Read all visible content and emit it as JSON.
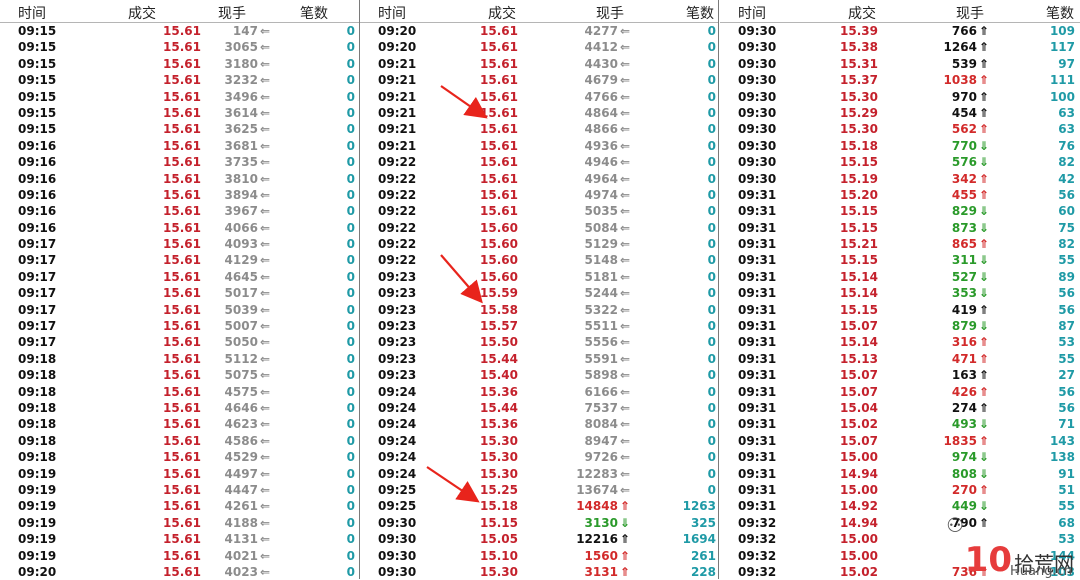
{
  "headers": {
    "time": "时间",
    "price": "成交",
    "vol": "现手",
    "count": "笔数"
  },
  "columns": [
    [
      [
        "09:15",
        "15.61",
        "147",
        "n",
        "0"
      ],
      [
        "09:15",
        "15.61",
        "3065",
        "n",
        "0"
      ],
      [
        "09:15",
        "15.61",
        "3180",
        "n",
        "0"
      ],
      [
        "09:15",
        "15.61",
        "3232",
        "n",
        "0"
      ],
      [
        "09:15",
        "15.61",
        "3496",
        "n",
        "0"
      ],
      [
        "09:15",
        "15.61",
        "3614",
        "n",
        "0"
      ],
      [
        "09:15",
        "15.61",
        "3625",
        "n",
        "0"
      ],
      [
        "09:16",
        "15.61",
        "3681",
        "n",
        "0"
      ],
      [
        "09:16",
        "15.61",
        "3735",
        "n",
        "0"
      ],
      [
        "09:16",
        "15.61",
        "3810",
        "n",
        "0"
      ],
      [
        "09:16",
        "15.61",
        "3894",
        "n",
        "0"
      ],
      [
        "09:16",
        "15.61",
        "3967",
        "n",
        "0"
      ],
      [
        "09:16",
        "15.61",
        "4066",
        "n",
        "0"
      ],
      [
        "09:17",
        "15.61",
        "4093",
        "n",
        "0"
      ],
      [
        "09:17",
        "15.61",
        "4129",
        "n",
        "0"
      ],
      [
        "09:17",
        "15.61",
        "4645",
        "n",
        "0"
      ],
      [
        "09:17",
        "15.61",
        "5017",
        "n",
        "0"
      ],
      [
        "09:17",
        "15.61",
        "5039",
        "n",
        "0"
      ],
      [
        "09:17",
        "15.61",
        "5007",
        "n",
        "0"
      ],
      [
        "09:17",
        "15.61",
        "5050",
        "n",
        "0"
      ],
      [
        "09:18",
        "15.61",
        "5112",
        "n",
        "0"
      ],
      [
        "09:18",
        "15.61",
        "5075",
        "n",
        "0"
      ],
      [
        "09:18",
        "15.61",
        "4575",
        "n",
        "0"
      ],
      [
        "09:18",
        "15.61",
        "4646",
        "n",
        "0"
      ],
      [
        "09:18",
        "15.61",
        "4623",
        "n",
        "0"
      ],
      [
        "09:18",
        "15.61",
        "4586",
        "n",
        "0"
      ],
      [
        "09:18",
        "15.61",
        "4529",
        "n",
        "0"
      ],
      [
        "09:19",
        "15.61",
        "4497",
        "n",
        "0"
      ],
      [
        "09:19",
        "15.61",
        "4447",
        "n",
        "0"
      ],
      [
        "09:19",
        "15.61",
        "4261",
        "n",
        "0"
      ],
      [
        "09:19",
        "15.61",
        "4188",
        "n",
        "0"
      ],
      [
        "09:19",
        "15.61",
        "4131",
        "n",
        "0"
      ],
      [
        "09:19",
        "15.61",
        "4021",
        "n",
        "0"
      ],
      [
        "09:20",
        "15.61",
        "4023",
        "n",
        "0"
      ]
    ],
    [
      [
        "09:20",
        "15.61",
        "4277",
        "n",
        "0"
      ],
      [
        "09:20",
        "15.61",
        "4412",
        "n",
        "0"
      ],
      [
        "09:21",
        "15.61",
        "4430",
        "n",
        "0"
      ],
      [
        "09:21",
        "15.61",
        "4679",
        "n",
        "0"
      ],
      [
        "09:21",
        "15.61",
        "4766",
        "n",
        "0"
      ],
      [
        "09:21",
        "15.61",
        "4864",
        "n",
        "0"
      ],
      [
        "09:21",
        "15.61",
        "4866",
        "n",
        "0"
      ],
      [
        "09:21",
        "15.61",
        "4936",
        "n",
        "0"
      ],
      [
        "09:22",
        "15.61",
        "4946",
        "n",
        "0"
      ],
      [
        "09:22",
        "15.61",
        "4964",
        "n",
        "0"
      ],
      [
        "09:22",
        "15.61",
        "4974",
        "n",
        "0"
      ],
      [
        "09:22",
        "15.61",
        "5035",
        "n",
        "0"
      ],
      [
        "09:22",
        "15.60",
        "5084",
        "n",
        "0"
      ],
      [
        "09:22",
        "15.60",
        "5129",
        "n",
        "0"
      ],
      [
        "09:22",
        "15.60",
        "5148",
        "n",
        "0"
      ],
      [
        "09:23",
        "15.60",
        "5181",
        "n",
        "0"
      ],
      [
        "09:23",
        "15.59",
        "5244",
        "n",
        "0"
      ],
      [
        "09:23",
        "15.58",
        "5322",
        "n",
        "0"
      ],
      [
        "09:23",
        "15.57",
        "5511",
        "n",
        "0"
      ],
      [
        "09:23",
        "15.50",
        "5556",
        "n",
        "0"
      ],
      [
        "09:23",
        "15.44",
        "5591",
        "n",
        "0"
      ],
      [
        "09:23",
        "15.40",
        "5898",
        "n",
        "0"
      ],
      [
        "09:24",
        "15.36",
        "6166",
        "n",
        "0"
      ],
      [
        "09:24",
        "15.44",
        "7537",
        "n",
        "0"
      ],
      [
        "09:24",
        "15.36",
        "8084",
        "n",
        "0"
      ],
      [
        "09:24",
        "15.30",
        "8947",
        "n",
        "0"
      ],
      [
        "09:24",
        "15.30",
        "9726",
        "n",
        "0"
      ],
      [
        "09:24",
        "15.30",
        "12283",
        "n",
        "0"
      ],
      [
        "09:25",
        "15.25",
        "13674",
        "n",
        "0"
      ],
      [
        "09:25",
        "15.18",
        "14848",
        "u",
        "1263"
      ],
      [
        "09:30",
        "15.15",
        "3130",
        "d",
        "325"
      ],
      [
        "09:30",
        "15.05",
        "12216",
        "b",
        "1694"
      ],
      [
        "09:30",
        "15.10",
        "1560",
        "u",
        "261"
      ],
      [
        "09:30",
        "15.30",
        "3131",
        "u",
        "228"
      ]
    ],
    [
      [
        "09:30",
        "15.39",
        "766",
        "b",
        "109"
      ],
      [
        "09:30",
        "15.38",
        "1264",
        "b",
        "117"
      ],
      [
        "09:30",
        "15.31",
        "539",
        "b",
        "97"
      ],
      [
        "09:30",
        "15.37",
        "1038",
        "u",
        "111"
      ],
      [
        "09:30",
        "15.30",
        "970",
        "b",
        "100"
      ],
      [
        "09:30",
        "15.29",
        "454",
        "b",
        "63"
      ],
      [
        "09:30",
        "15.30",
        "562",
        "u",
        "63"
      ],
      [
        "09:30",
        "15.18",
        "770",
        "d",
        "76"
      ],
      [
        "09:30",
        "15.15",
        "576",
        "d",
        "82"
      ],
      [
        "09:30",
        "15.19",
        "342",
        "u",
        "42"
      ],
      [
        "09:31",
        "15.20",
        "455",
        "u",
        "56"
      ],
      [
        "09:31",
        "15.15",
        "829",
        "d",
        "60"
      ],
      [
        "09:31",
        "15.15",
        "873",
        "d",
        "75"
      ],
      [
        "09:31",
        "15.21",
        "865",
        "u",
        "82"
      ],
      [
        "09:31",
        "15.15",
        "311",
        "d",
        "55"
      ],
      [
        "09:31",
        "15.14",
        "527",
        "d",
        "89"
      ],
      [
        "09:31",
        "15.14",
        "353",
        "d",
        "56"
      ],
      [
        "09:31",
        "15.15",
        "419",
        "b",
        "56"
      ],
      [
        "09:31",
        "15.07",
        "879",
        "d",
        "87"
      ],
      [
        "09:31",
        "15.14",
        "316",
        "u",
        "53"
      ],
      [
        "09:31",
        "15.13",
        "471",
        "u",
        "55"
      ],
      [
        "09:31",
        "15.07",
        "163",
        "b",
        "27"
      ],
      [
        "09:31",
        "15.07",
        "426",
        "u",
        "56"
      ],
      [
        "09:31",
        "15.04",
        "274",
        "b",
        "56"
      ],
      [
        "09:31",
        "15.02",
        "493",
        "d",
        "71"
      ],
      [
        "09:31",
        "15.07",
        "1835",
        "u",
        "143"
      ],
      [
        "09:31",
        "15.00",
        "974",
        "d",
        "138"
      ],
      [
        "09:31",
        "14.94",
        "808",
        "d",
        "91"
      ],
      [
        "09:31",
        "15.00",
        "270",
        "u",
        "51"
      ],
      [
        "09:31",
        "14.92",
        "449",
        "d",
        "55"
      ],
      [
        "09:32",
        "14.94",
        "790",
        "b",
        "68"
      ],
      [
        "09:32",
        "15.00",
        "",
        "",
        "53"
      ],
      [
        "09:32",
        "15.00",
        "",
        "",
        "144"
      ],
      [
        "09:32",
        "15.02",
        "736",
        "u",
        "103"
      ]
    ]
  ],
  "watermark": {
    "brand": "拾荒网",
    "number": "10",
    "domain": "Huang.cn"
  },
  "annotations": [
    {
      "target_column": 1,
      "target_row": 5
    },
    {
      "target_column": 1,
      "target_row": 17
    },
    {
      "target_column": 1,
      "target_row": 29
    }
  ]
}
